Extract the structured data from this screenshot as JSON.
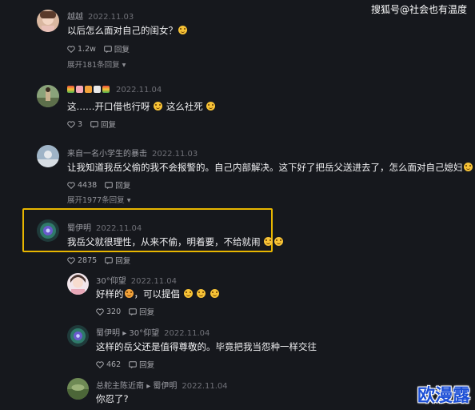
{
  "watermark": "搜狐号@社会也有温度",
  "logo_text": "欧漫露",
  "colors": {
    "background": "#16181d",
    "highlight_border": "#e8b600"
  },
  "comments": [
    {
      "username": "越越",
      "date": "2022.11.03",
      "text": "以后怎么面对自己的闺女？",
      "likes": "1.2w",
      "reply_label": "回复",
      "expand_label": "展开181条回复"
    },
    {
      "username_badges": [
        "rainbow",
        "pig",
        "tiger",
        "rabbit",
        "rainbow"
      ],
      "date": "2022.11.04",
      "text": "这……开口借也行呀",
      "text_suffix": "这么社死",
      "likes": "3",
      "reply_label": "回复"
    },
    {
      "username": "来自一名小学生的暴击",
      "date": "2022.11.03",
      "text": "让我知道我岳父偷的我不会报警的。自己内部解决。这下好了把岳父送进去了，怎么面对自己媳妇",
      "likes": "4438",
      "reply_label": "回复",
      "expand_label": "展开1977条回复"
    },
    {
      "username": "蜀伊明",
      "date": "2022.11.04",
      "text": "我岳父就很理性，从来不偷，明着要，不给就闹",
      "likes": "2875",
      "reply_label": "回复"
    }
  ],
  "replies": [
    {
      "username": "30°仰望",
      "date": "2022.11.04",
      "text": "好样的",
      "text_suffix": "，可以提倡",
      "likes": "320",
      "reply_label": "回复"
    },
    {
      "username": "蜀伊明",
      "reply_to": "30°仰望",
      "date": "2022.11.04",
      "text": "这样的岳父还是值得尊敬的。毕竟把我当怨种一样交往",
      "likes": "462",
      "reply_label": "回复"
    },
    {
      "username": "总舵主陈近南",
      "reply_to": "蜀伊明",
      "date": "2022.11.04",
      "text": "你忍了?"
    }
  ]
}
